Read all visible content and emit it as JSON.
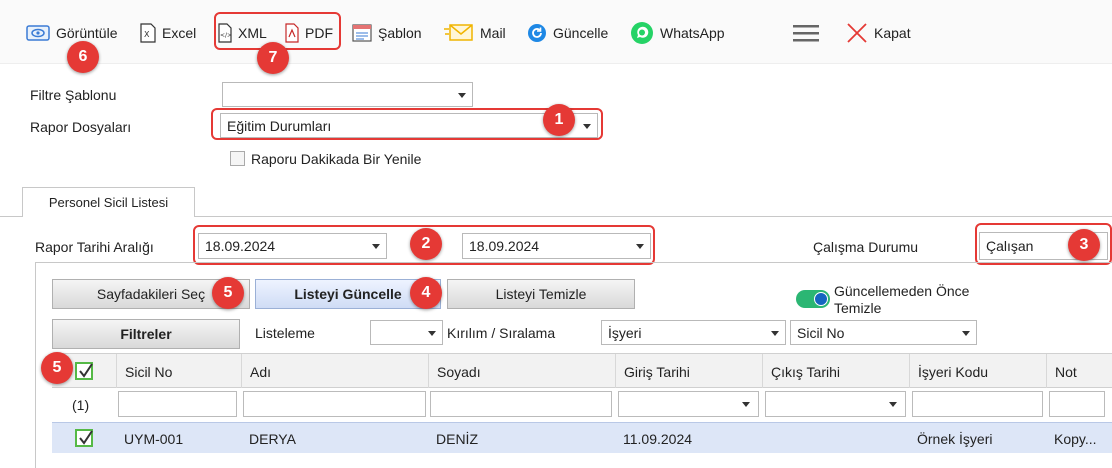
{
  "toolbar": {
    "view": "Görüntüle",
    "excel": "Excel",
    "xml": "XML",
    "pdf": "PDF",
    "template": "Şablon",
    "mail": "Mail",
    "refresh": "Güncelle",
    "whatsapp": "WhatsApp",
    "close": "Kapat"
  },
  "badges": [
    "1",
    "2",
    "3",
    "4",
    "5",
    "5",
    "6",
    "7"
  ],
  "form": {
    "filter_template_label": "Filtre Şablonu",
    "filter_template_value": "",
    "report_files_label": "Rapor Dosyaları",
    "report_files_value": "Eğitim Durumları",
    "auto_refresh_label": "Raporu Dakikada Bir Yenile"
  },
  "tab": {
    "label": "Personel Sicil Listesi"
  },
  "range": {
    "label": "Rapor Tarihi Aralığı",
    "start": "18.09.2024",
    "end": "18.09.2024",
    "work_status_label": "Çalışma Durumu",
    "work_status_value": "Çalışan"
  },
  "actions": {
    "select_page": "Sayfadakileri Seç",
    "update_list": "Listeyi Güncelle",
    "clear_list": "Listeyi Temizle",
    "clear_before_update": "Güncellemeden Önce",
    "clear_before_update_2": "Temizle"
  },
  "filters": {
    "button": "Filtreler",
    "listing_label": "Listeleme",
    "listing_value": "",
    "breakdown_label": "Kırılım / Sıralama",
    "breakdown_value": "İşyeri",
    "sort_value": "Sicil No"
  },
  "grid": {
    "columns": [
      "Sicil No",
      "Adı",
      "Soyadı",
      "Giriş Tarihi",
      "Çıkış Tarihi",
      "İşyeri Kodu",
      "Not"
    ],
    "count": "(1)",
    "rows": [
      {
        "sicil": "UYM-001",
        "ad": "DERYA",
        "soyad": "DENİZ",
        "giris": "11.09.2024",
        "cikis": "",
        "isyeri": "Örnek İşyeri",
        "not": "Kopy..."
      }
    ]
  },
  "colors": {
    "badge": "#e53935",
    "highlight_row": "#dde6f7",
    "toggle_on": "#2bb673"
  }
}
